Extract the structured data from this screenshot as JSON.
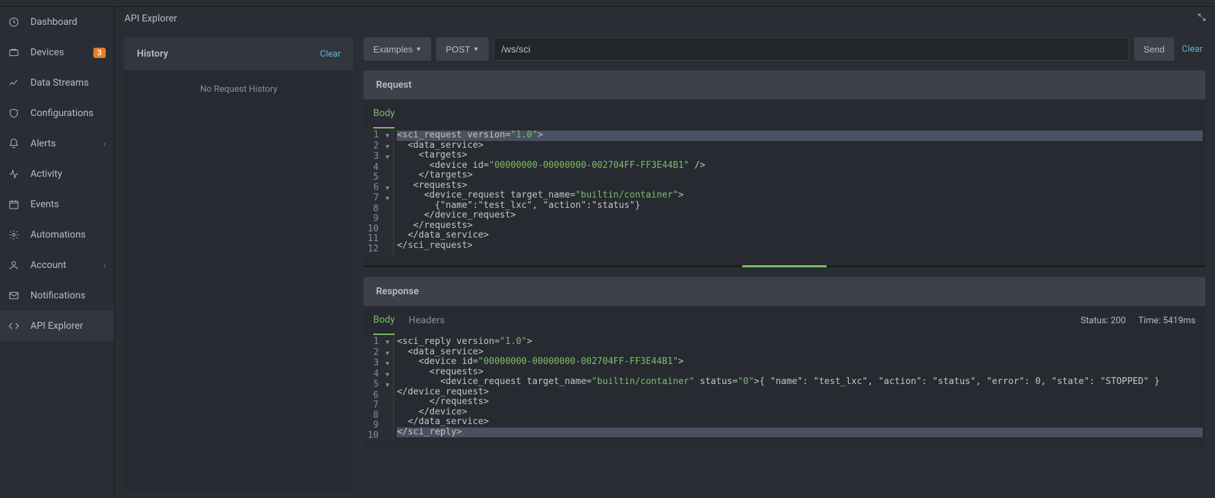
{
  "page_title": "API Explorer",
  "sidebar": {
    "items": [
      {
        "id": "dashboard",
        "label": "Dashboard"
      },
      {
        "id": "devices",
        "label": "Devices",
        "badge": "3"
      },
      {
        "id": "data-streams",
        "label": "Data Streams"
      },
      {
        "id": "configurations",
        "label": "Configurations"
      },
      {
        "id": "alerts",
        "label": "Alerts",
        "expandable": true
      },
      {
        "id": "activity",
        "label": "Activity"
      },
      {
        "id": "events",
        "label": "Events"
      },
      {
        "id": "automations",
        "label": "Automations"
      },
      {
        "id": "account",
        "label": "Account",
        "expandable": true
      },
      {
        "id": "notifications",
        "label": "Notifications"
      },
      {
        "id": "api-explorer",
        "label": "API Explorer",
        "active": true
      }
    ]
  },
  "history": {
    "title": "History",
    "clear": "Clear",
    "empty": "No Request History"
  },
  "toolbar": {
    "examples": "Examples",
    "method": "POST",
    "url": "/ws/sci",
    "send": "Send",
    "clear": "Clear"
  },
  "request": {
    "title": "Request",
    "tabs": {
      "body": "Body"
    },
    "lines": [
      {
        "n": 1,
        "fold": true,
        "html": "<span class='tag'>&lt;sci_request</span> <span class='attr'>version</span>=<span class='str'>\"1.0\"</span><span class='tag'>&gt;</span>",
        "sel": true
      },
      {
        "n": 2,
        "fold": true,
        "html": "  <span class='tag'>&lt;data_service&gt;</span>"
      },
      {
        "n": 3,
        "fold": true,
        "html": "    <span class='tag'>&lt;targets&gt;</span>"
      },
      {
        "n": 4,
        "html": "      <span class='tag'>&lt;device</span> <span class='attr'>id</span>=<span class='str'>\"00000000-00000000-002704FF-FF3E44B1\"</span> <span class='tag'>/&gt;</span>"
      },
      {
        "n": 5,
        "html": "    <span class='tag'>&lt;/targets&gt;</span>"
      },
      {
        "n": 6,
        "fold": true,
        "html": "   <span class='tag'>&lt;requests&gt;</span>"
      },
      {
        "n": 7,
        "fold": true,
        "html": "     <span class='tag'>&lt;device_request</span> <span class='attr'>target_name</span>=<span class='str'>\"builtin/container\"</span><span class='tag'>&gt;</span>"
      },
      {
        "n": 8,
        "html": "       <span class='txt'>{\"name\":\"test_lxc\", \"action\":\"status\"}</span>"
      },
      {
        "n": 9,
        "html": "     <span class='tag'>&lt;/device_request&gt;</span>"
      },
      {
        "n": 10,
        "html": "   <span class='tag'>&lt;/requests&gt;</span>"
      },
      {
        "n": 11,
        "html": "  <span class='tag'>&lt;/data_service&gt;</span>"
      },
      {
        "n": 12,
        "html": "<span class='tag'>&lt;/sci_request&gt;</span>"
      }
    ]
  },
  "response": {
    "title": "Response",
    "tabs": {
      "body": "Body",
      "headers": "Headers"
    },
    "status_label": "Status:",
    "status_value": "200",
    "time_label": "Time:",
    "time_value": "5419ms",
    "lines": [
      {
        "n": 1,
        "fold": true,
        "html": "<span class='tag'>&lt;sci_reply</span> <span class='attr'>version</span>=<span class='str'>\"1.0\"</span><span class='tag'>&gt;</span>"
      },
      {
        "n": 2,
        "fold": true,
        "html": "  <span class='tag'>&lt;data_service&gt;</span>"
      },
      {
        "n": 3,
        "fold": true,
        "html": "    <span class='tag'>&lt;device</span> <span class='attr'>id</span>=<span class='str'>\"00000000-00000000-002704FF-FF3E44B1\"</span><span class='tag'>&gt;</span>"
      },
      {
        "n": 4,
        "fold": true,
        "html": "      <span class='tag'>&lt;requests&gt;</span>"
      },
      {
        "n": 5,
        "fold": true,
        "html": "        <span class='tag'>&lt;device_request</span> <span class='attr'>target_name</span>=<span class='str'>\"builtin/container\"</span> <span class='attr'>status</span>=<span class='str'>\"0\"</span><span class='tag'>&gt;</span><span class='txt'>{ \"name\": \"test_lxc\", \"action\": \"status\", \"error\": 0, \"state\": \"STOPPED\" }</span>"
      },
      {
        "n": 6,
        "html": "<span class='tag'>&lt;/device_request&gt;</span>"
      },
      {
        "n": 7,
        "html": "      <span class='tag'>&lt;/requests&gt;</span>"
      },
      {
        "n": 8,
        "html": "    <span class='tag'>&lt;/device&gt;</span>"
      },
      {
        "n": 9,
        "html": "  <span class='tag'>&lt;/data_service&gt;</span>"
      },
      {
        "n": 10,
        "html": "<span class='tag'>&lt;/sci_reply&gt;</span>",
        "sel": true
      }
    ]
  }
}
